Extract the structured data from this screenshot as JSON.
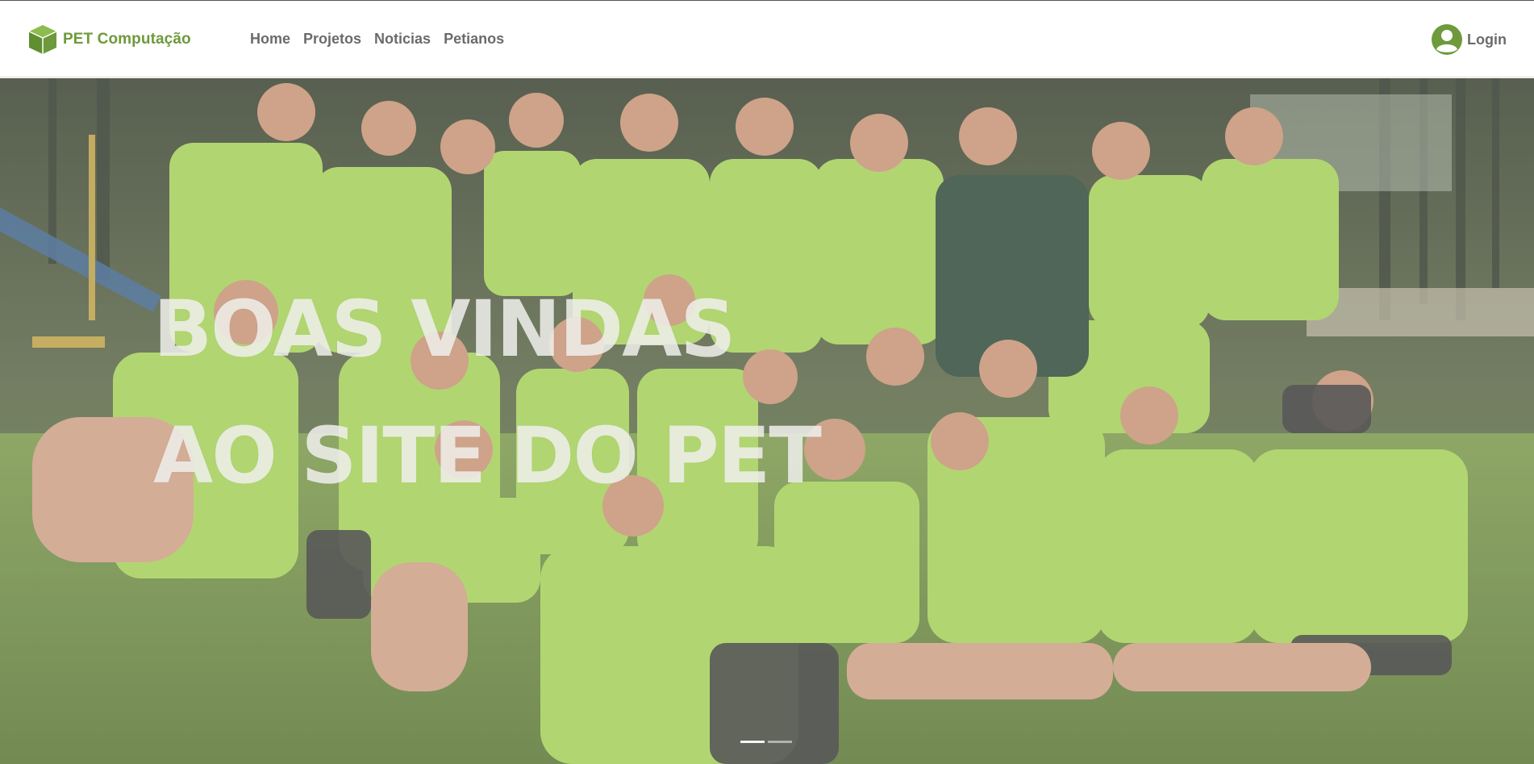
{
  "brand": {
    "name": "PET Computação",
    "logo_icon": "green-cube-icon",
    "color": "#6e9a3b"
  },
  "nav": {
    "items": [
      {
        "label": "Home"
      },
      {
        "label": "Projetos"
      },
      {
        "label": "Noticias"
      },
      {
        "label": "Petianos"
      }
    ]
  },
  "login": {
    "label": "Login",
    "icon": "user-circle-icon"
  },
  "hero": {
    "line1": "BOAS VINDAS",
    "line2": "AO SITE DO PET",
    "carousel": {
      "slides": 2,
      "active": 1
    }
  },
  "colors": {
    "accent": "#6e9a3b",
    "nav_text": "#6b6b6b",
    "shirt_green": "#9ccb4a"
  }
}
